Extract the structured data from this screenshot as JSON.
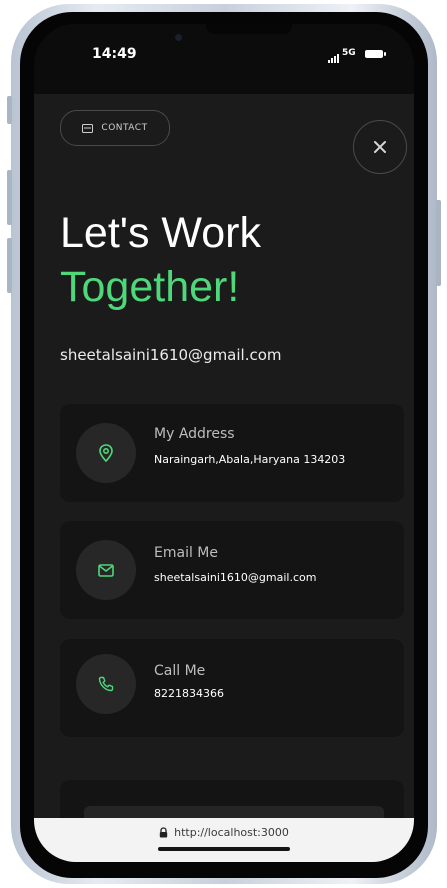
{
  "status_bar": {
    "time": "14:49",
    "network": "5G"
  },
  "contact_pill": {
    "label": "CONTACT",
    "icon": "mail-icon"
  },
  "close_button": {
    "icon": "close-icon"
  },
  "heading": {
    "line1": "Let's Work",
    "line2": "Together!"
  },
  "email": "sheetalsaini1610@gmail.com",
  "cards": [
    {
      "title": "My Address",
      "value": "Naraingarh,Abala,Haryana 134203",
      "icon": "location-pin-icon"
    },
    {
      "title": "Email Me",
      "value": "sheetalsaini1610@gmail.com",
      "icon": "mail-icon"
    },
    {
      "title": "Call Me",
      "value": "8221834366",
      "icon": "phone-icon"
    }
  ],
  "browser": {
    "url": "http://localhost:3000",
    "icon": "lock-icon"
  },
  "colors": {
    "accent": "#4ed87a",
    "background": "#1b1b1b",
    "card": "#141414"
  }
}
